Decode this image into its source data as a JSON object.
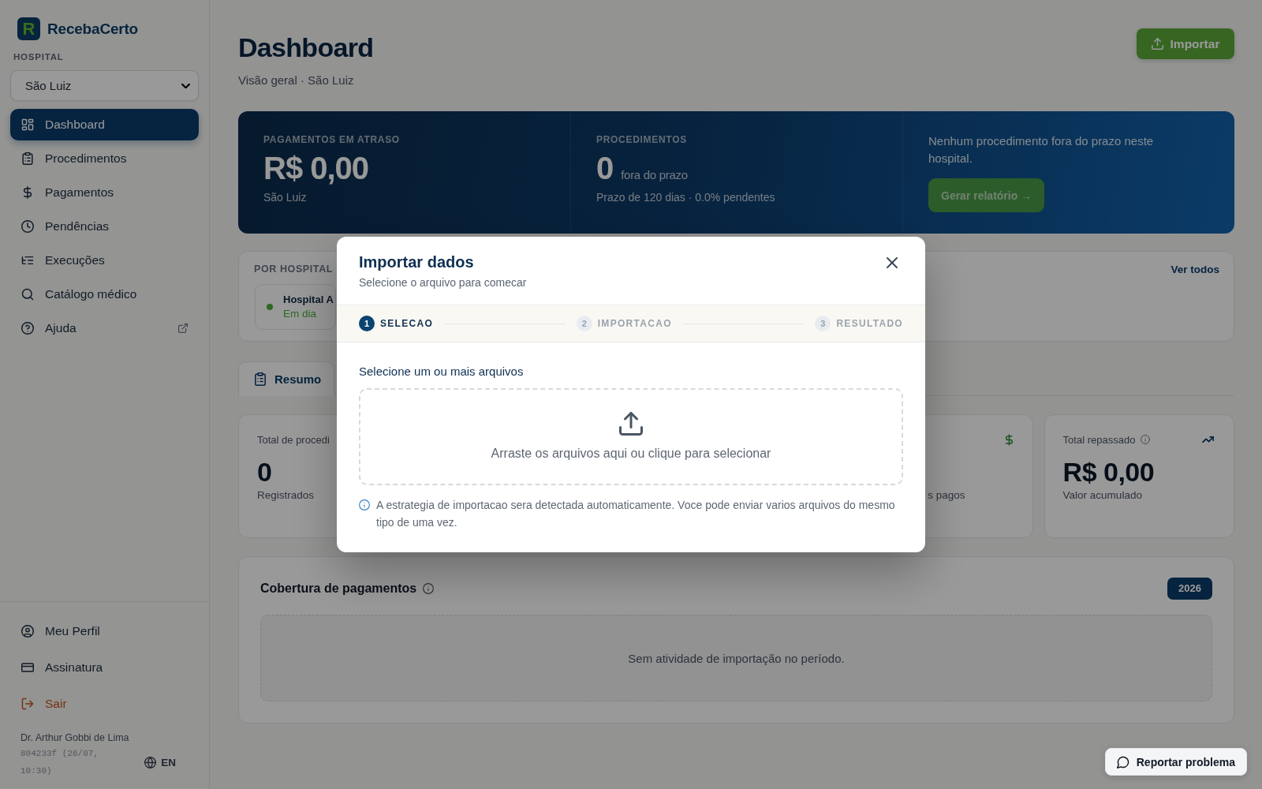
{
  "sidebar": {
    "logo": {
      "mark": "R",
      "name": "RecebaCerto"
    },
    "hospital_select": {
      "label": "HOSPITAL",
      "value": "São Luiz"
    },
    "nav": [
      {
        "label": "Dashboard",
        "selected": true,
        "external": false
      },
      {
        "label": "Procedimentos",
        "selected": false,
        "external": false
      },
      {
        "label": "Pagamentos",
        "selected": false,
        "external": false
      },
      {
        "label": "Pendências",
        "selected": false,
        "external": false
      },
      {
        "label": "Execuções",
        "selected": false,
        "external": false
      },
      {
        "label": "Catálogo médico",
        "selected": false,
        "external": false
      },
      {
        "label": "Ajuda",
        "selected": false,
        "external": true
      }
    ],
    "footer_nav": [
      {
        "label": "Meu Perfil",
        "kind": "link"
      },
      {
        "label": "Assinatura",
        "kind": "link"
      },
      {
        "label": "Sair",
        "kind": "logout"
      }
    ],
    "user_name": "Dr. Arthur Gobbi de Lima",
    "version": "804233f (26/07, 10:30)",
    "language": "EN"
  },
  "header": {
    "title": "Dashboard",
    "subtitle": "Visão geral · São Luiz",
    "import_button": "Importar"
  },
  "banner": {
    "columns": [
      {
        "kind": "amount",
        "label": "PAGAMENTOS EM ATRASO",
        "value": "R$ 0,00",
        "note": "São Luiz"
      },
      {
        "kind": "count",
        "label": "PROCEDIMENTOS",
        "value": "0",
        "unit": "fora do prazo",
        "note": "Prazo de 120 dias · 0.0% pendentes"
      },
      {
        "kind": "message",
        "text": "Nenhum procedimento fora do prazo neste hospital.",
        "button": "Gerar relatório →"
      }
    ]
  },
  "by_hospital": {
    "label": "POR HOSPITAL",
    "link": "Ver todos",
    "hospitals": [
      {
        "name": "Hospital A",
        "status": "Em dia"
      }
    ]
  },
  "tabs": [
    {
      "label": "Resumo",
      "selected": true
    }
  ],
  "stat_cards": [
    {
      "kind": "clipped_right",
      "label": "Total de procedi",
      "value": "0",
      "note": "Registrados"
    },
    {
      "kind": "clipped_left",
      "note": "s pagos"
    },
    {
      "kind": "full",
      "label": "Total repassado",
      "value": "R$ 0,00",
      "note": "Valor acumulado"
    }
  ],
  "coverage": {
    "title": "Cobertura de pagamentos",
    "year": "2026",
    "empty_text": "Sem atividade de importação no período."
  },
  "report_button": "Reportar problema",
  "modal": {
    "title": "Importar dados",
    "subtitle": "Selecione o arquivo para comecar",
    "steps": [
      {
        "number": "1",
        "label": "SELECAO",
        "active": true
      },
      {
        "number": "2",
        "label": "IMPORTACAO",
        "active": false
      },
      {
        "number": "3",
        "label": "RESULTADO",
        "active": false
      }
    ],
    "files_label": "Selecione um ou mais arquivos",
    "dropzone_text": "Arraste os arquivos aqui ou clique para selecionar",
    "note": "A estrategia de importacao sera detectada automaticamente. Voce pode enviar varios arquivos do mesmo tipo de uma vez."
  }
}
